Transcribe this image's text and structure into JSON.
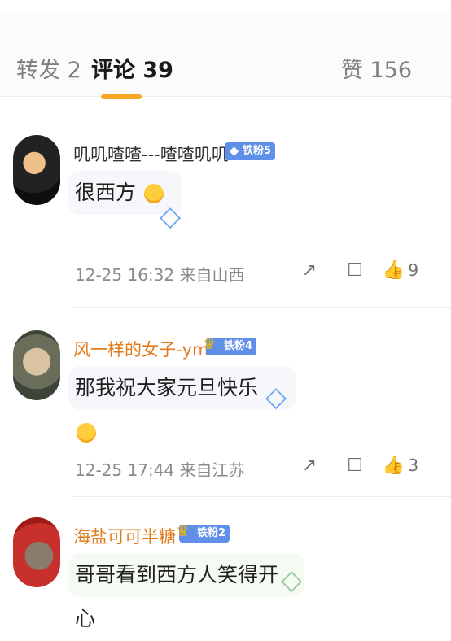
{
  "tabs": {
    "forward": "转发 2",
    "comments": "评论 39",
    "likes": "赞 156",
    "accent": "#f5a623"
  },
  "comments": [
    {
      "username": "叽叽喳喳---喳喳叽叽",
      "badge": "铁粉5",
      "text": "很西方",
      "time": "12-25 16:32",
      "location": "来自山西",
      "likes": "9"
    },
    {
      "username": "风一样的女子-ym",
      "badge": "铁粉4",
      "text": "那我祝大家元旦快乐",
      "time": "12-25 17:44",
      "location": "来自江苏",
      "likes": "3"
    },
    {
      "username": "海盐可可半糖",
      "badge": "铁粉2",
      "text": "哥哥看到西方人笑得开心"
    }
  ],
  "icons": {
    "share": "share-icon",
    "comment": "comment-icon",
    "like": "thumbs-up-icon",
    "badge": "diamond-icon",
    "crown": "crown-icon"
  }
}
